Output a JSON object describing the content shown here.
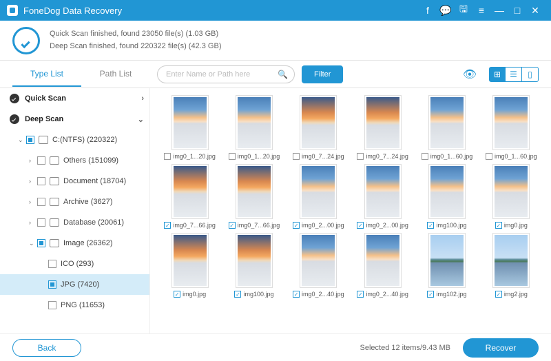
{
  "title": "FoneDog Data Recovery",
  "scan": {
    "quick": "Quick Scan finished, found 23050 file(s) (1.03 GB)",
    "deep": "Deep Scan finished, found 220322 file(s) (42.3 GB)"
  },
  "tabs": {
    "type": "Type List",
    "path": "Path List"
  },
  "search": {
    "placeholder": "Enter Name or Path here"
  },
  "filter": "Filter",
  "tree": {
    "quickScan": "Quick Scan",
    "deepScan": "Deep Scan",
    "drive": "C:(NTFS) (220322)",
    "others": "Others (151099)",
    "document": "Document (18704)",
    "archive": "Archive (3627)",
    "database": "Database (20061)",
    "image": "Image (26362)",
    "ico": "ICO (293)",
    "jpg": "JPG (7420)",
    "png": "PNG (11653)"
  },
  "thumbs": [
    {
      "name": "img0_1...20.jpg",
      "checked": false,
      "variant": "sky"
    },
    {
      "name": "img0_1...20.jpg",
      "checked": false,
      "variant": "sky"
    },
    {
      "name": "img0_7...24.jpg",
      "checked": false,
      "variant": "sunset"
    },
    {
      "name": "img0_7...24.jpg",
      "checked": false,
      "variant": "sunset"
    },
    {
      "name": "img0_1...60.jpg",
      "checked": false,
      "variant": "sky"
    },
    {
      "name": "img0_1...60.jpg",
      "checked": false,
      "variant": "sky"
    },
    {
      "name": "img0_7...66.jpg",
      "checked": true,
      "variant": "sunset"
    },
    {
      "name": "img0_7...66.jpg",
      "checked": true,
      "variant": "sunset"
    },
    {
      "name": "img0_2...00.jpg",
      "checked": true,
      "variant": "sky"
    },
    {
      "name": "img0_2...00.jpg",
      "checked": true,
      "variant": "sky"
    },
    {
      "name": "img100.jpg",
      "checked": true,
      "variant": "sky"
    },
    {
      "name": "img0.jpg",
      "checked": true,
      "variant": "sky"
    },
    {
      "name": "img0.jpg",
      "checked": true,
      "variant": "sunset"
    },
    {
      "name": "img100.jpg",
      "checked": true,
      "variant": "sunset"
    },
    {
      "name": "img0_2...40.jpg",
      "checked": true,
      "variant": "sky"
    },
    {
      "name": "img0_2...40.jpg",
      "checked": true,
      "variant": "sky"
    },
    {
      "name": "img102.jpg",
      "checked": true,
      "variant": "island"
    },
    {
      "name": "img2.jpg",
      "checked": true,
      "variant": "island"
    }
  ],
  "footer": {
    "back": "Back",
    "selected": "Selected 12 items/9.43 MB",
    "recover": "Recover"
  }
}
